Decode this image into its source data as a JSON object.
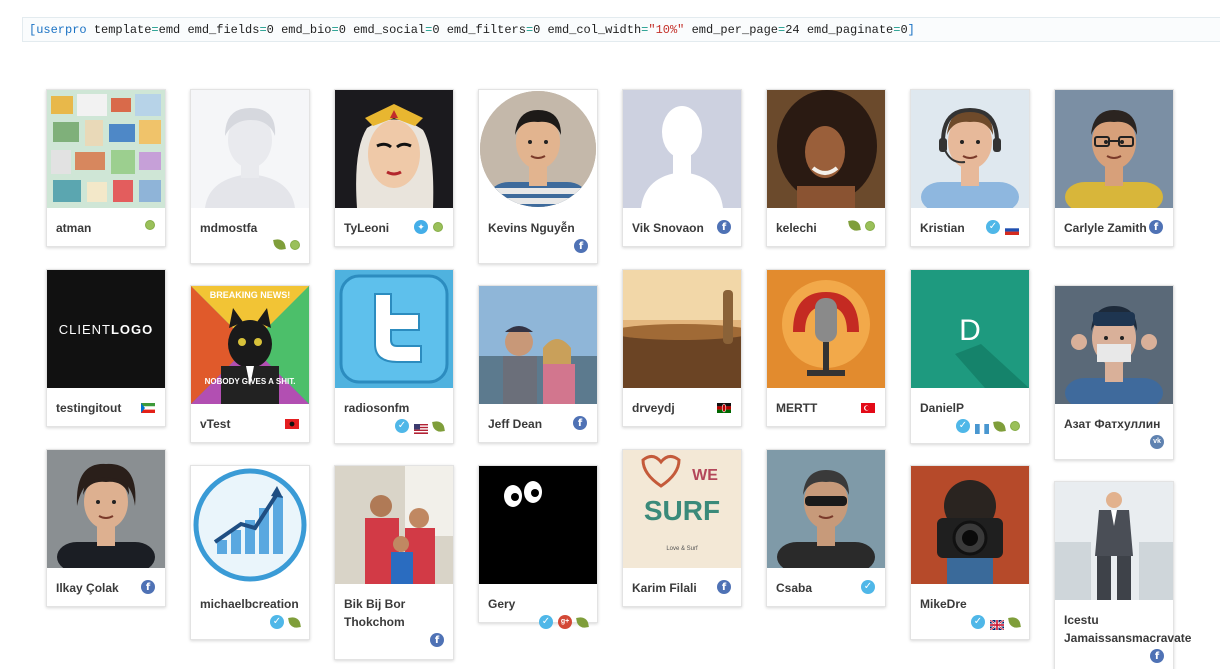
{
  "shortcode": {
    "open": "[userpro ",
    "attrs": [
      {
        "key": "template",
        "value": "emd"
      },
      {
        "key": "emd_fields",
        "value": "0"
      },
      {
        "key": "emd_bio",
        "value": "0"
      },
      {
        "key": "emd_social",
        "value": "0"
      },
      {
        "key": "emd_filters",
        "value": "0"
      },
      {
        "key": "emd_col_width",
        "value": "\"10%\""
      },
      {
        "key": "emd_per_page",
        "value": "24"
      },
      {
        "key": "emd_paginate",
        "value": "0"
      }
    ],
    "close": "]"
  },
  "members": [
    {
      "name": "atman",
      "badges": [
        "online-dot"
      ]
    },
    {
      "name": "mdmostfa",
      "badges": [
        "leaf-icon",
        "online-dot"
      ]
    },
    {
      "name": "TyLeoni",
      "badges": [
        "twitter-icon",
        "online-dot"
      ]
    },
    {
      "name": "Kevins Nguyễn",
      "badges": [
        "facebook-icon"
      ]
    },
    {
      "name": "Vik Snovaon",
      "badges": [
        "facebook-icon"
      ]
    },
    {
      "name": "kelechi",
      "badges": [
        "leaf-icon",
        "online-dot"
      ]
    },
    {
      "name": "Kristian",
      "badges": [
        "verified-icon",
        "flag-russia"
      ]
    },
    {
      "name": "Carlyle Zamith",
      "badges": [
        "facebook-icon"
      ]
    },
    {
      "name": "testingitout",
      "badges": [
        "flag-equatorial-guinea"
      ]
    },
    {
      "name": "vTest",
      "badges": [
        "flag-albania"
      ]
    },
    {
      "name": "radiosonfm",
      "badges": [
        "verified-icon",
        "flag-usa",
        "leaf-icon"
      ]
    },
    {
      "name": "Jeff Dean",
      "badges": [
        "facebook-icon"
      ]
    },
    {
      "name": "drveydj",
      "badges": [
        "flag-kenya"
      ]
    },
    {
      "name": "MERTT",
      "badges": [
        "flag-turkey"
      ]
    },
    {
      "name": "DanielP",
      "badges": [
        "verified-icon",
        "flag-guatemala",
        "leaf-icon",
        "online-dot"
      ]
    },
    {
      "name": "Азат Фатхуллин",
      "badges": [
        "vk-icon"
      ]
    },
    {
      "name": "Ilkay Çolak",
      "badges": [
        "facebook-icon"
      ]
    },
    {
      "name": "michaelbcreation",
      "badges": [
        "verified-icon",
        "leaf-icon"
      ]
    },
    {
      "name": "Bik Bij Bor Thokchom",
      "badges": [
        "facebook-icon"
      ]
    },
    {
      "name": "Gery",
      "badges": [
        "verified-icon",
        "google-plus-icon",
        "leaf-icon"
      ]
    },
    {
      "name": "Karim Filali",
      "badges": [
        "facebook-icon"
      ]
    },
    {
      "name": "Csaba",
      "badges": [
        "verified-icon"
      ]
    },
    {
      "name": "MikeDre",
      "badges": [
        "verified-icon",
        "flag-uk",
        "leaf-icon"
      ]
    },
    {
      "name": "Icestu Jamaissansmacravate",
      "badges": [
        "facebook-icon"
      ]
    }
  ],
  "photo_text": {
    "clientlogo": "CLIENTLOGO",
    "meme_top": "BREAKING NEWS!",
    "meme_bottom": "NOBODY GIVES A SHIT.",
    "avatar_letter": "D",
    "surf_a": "WE",
    "surf_b": "SURF",
    "surf_c": "Love & Surf"
  },
  "colors": {
    "facebook": "#4f72b5",
    "twitter": "#44aee8",
    "verified": "#4fb7e8",
    "online": "#9ac05a",
    "leaf": "#7f9e3a",
    "avatar_teal": "#1e9a7f"
  }
}
